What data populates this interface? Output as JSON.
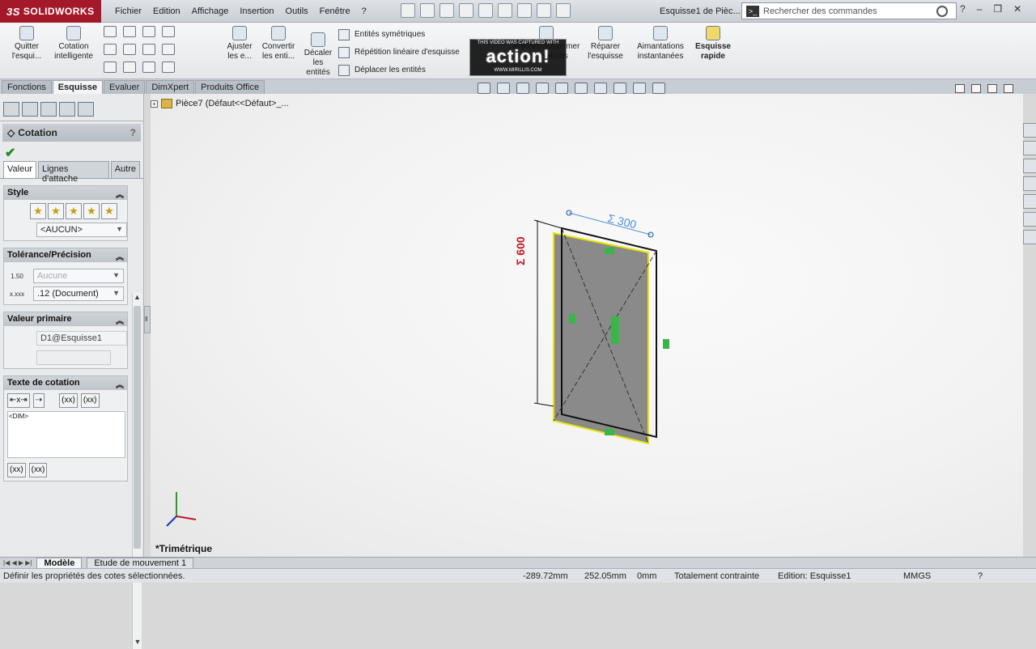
{
  "app": {
    "brand": "SOLIDWORKS",
    "doc_title": "Esquisse1 de Pièc...",
    "search_placeholder": "Rechercher des commandes",
    "help": "?"
  },
  "menu": [
    "Fichier",
    "Edition",
    "Affichage",
    "Insertion",
    "Outils",
    "Fenêtre"
  ],
  "watermark": {
    "line1": "THIS VIDEO WAS CAPTURED WITH",
    "big": "action!",
    "line2": "WWW.MIRILLIS.COM"
  },
  "ribbon": {
    "quitter": "Quitter l'esqui...",
    "cotation": "Cotation intelligente",
    "ajuster": "Ajuster les e...",
    "convertir": "Convertir les enti...",
    "decaler": "Décaler les entités",
    "entites_sym": "Entités symétriques",
    "repetition": "Répétition linéaire d'esquisse",
    "deplacer": "Déplacer les entités",
    "relations": "Afficher/Supprimer les relations",
    "reparer": "Réparer l'esquisse",
    "aimantations": "Aimantations instantanées",
    "esquisse_rapide": "Esquisse rapide"
  },
  "tabs": [
    "Fonctions",
    "Esquisse",
    "Evaluer",
    "DimXpert",
    "Produits Office"
  ],
  "tree": {
    "part": "Pièce7  (Défaut<<Défaut>_..."
  },
  "pm": {
    "title": "Cotation",
    "ok": "✔",
    "tabs": [
      "Valeur",
      "Lignes d'attache",
      "Autre"
    ],
    "style": {
      "header": "Style",
      "dropdown": "<AUCUN>"
    },
    "tolerance": {
      "header": "Tolérance/Précision",
      "tol_dropdown": "Aucune",
      "tol_icon": "1.50",
      "prec_icon": "x.xxx",
      "prec_dropdown": ".12 (Document)"
    },
    "primary": {
      "header": "Valeur primaire",
      "name": "D1@Esquisse1"
    },
    "dimtext": {
      "header": "Texte de cotation",
      "text": "<DIM>",
      "btn1": "⇤x⇥",
      "btn2": "⇢",
      "btn3": "(xx)",
      "btn4": "(xx)",
      "btn5": "(xx)",
      "btn6": "(xx)"
    }
  },
  "viewport": {
    "dim_top": "Σ 300",
    "dim_left": "Σ 600",
    "view_name": "*Trimétrique"
  },
  "model_tabs": [
    "Modèle",
    "Etude de mouvement 1"
  ],
  "status": {
    "message": "Définir les propriétés des cotes sélectionnées.",
    "x": "-289.72mm",
    "y": "252.05mm",
    "z": "0mm",
    "constraint": "Totalement contrainte",
    "editing": "Edition: Esquisse1",
    "units": "MMGS"
  }
}
